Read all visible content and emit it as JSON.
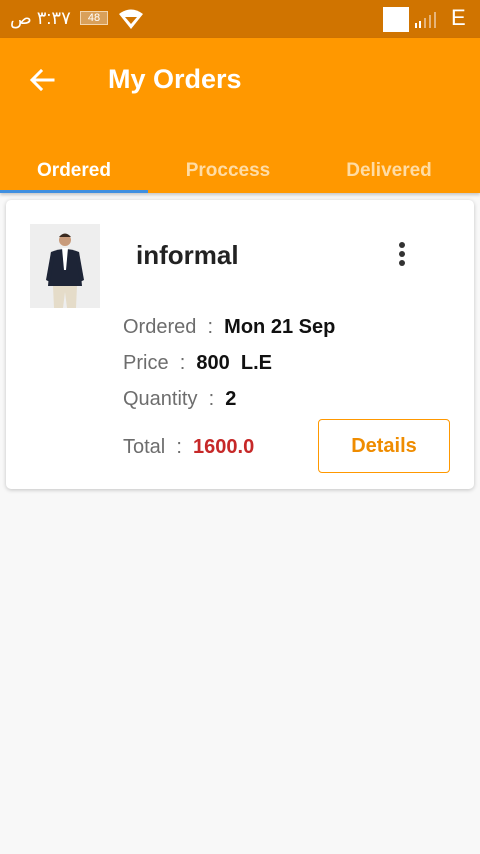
{
  "status_bar": {
    "time": "۳:۳۷ ص",
    "battery": "48",
    "network": "E",
    "icons": [
      "wifi-icon",
      "signal-icon"
    ]
  },
  "app_bar": {
    "title": "My Orders",
    "back_icon": "arrow-left-icon",
    "color": "#ff9800"
  },
  "tabs": [
    {
      "label": "Ordered",
      "active": true
    },
    {
      "label": "Proccess",
      "active": false
    },
    {
      "label": "Delivered",
      "active": false
    }
  ],
  "order": {
    "name": "informal",
    "menu_icon": "more-vertical-icon",
    "ordered_label": "Ordered",
    "ordered_value": "Mon 21 Sep",
    "price_label": "Price",
    "price_value": "800  L.E",
    "quantity_label": "Quantity",
    "quantity_value": "2",
    "total_label": "Total",
    "total_value": "1600.0",
    "total_color": "#c62828",
    "details_label": "Details"
  }
}
